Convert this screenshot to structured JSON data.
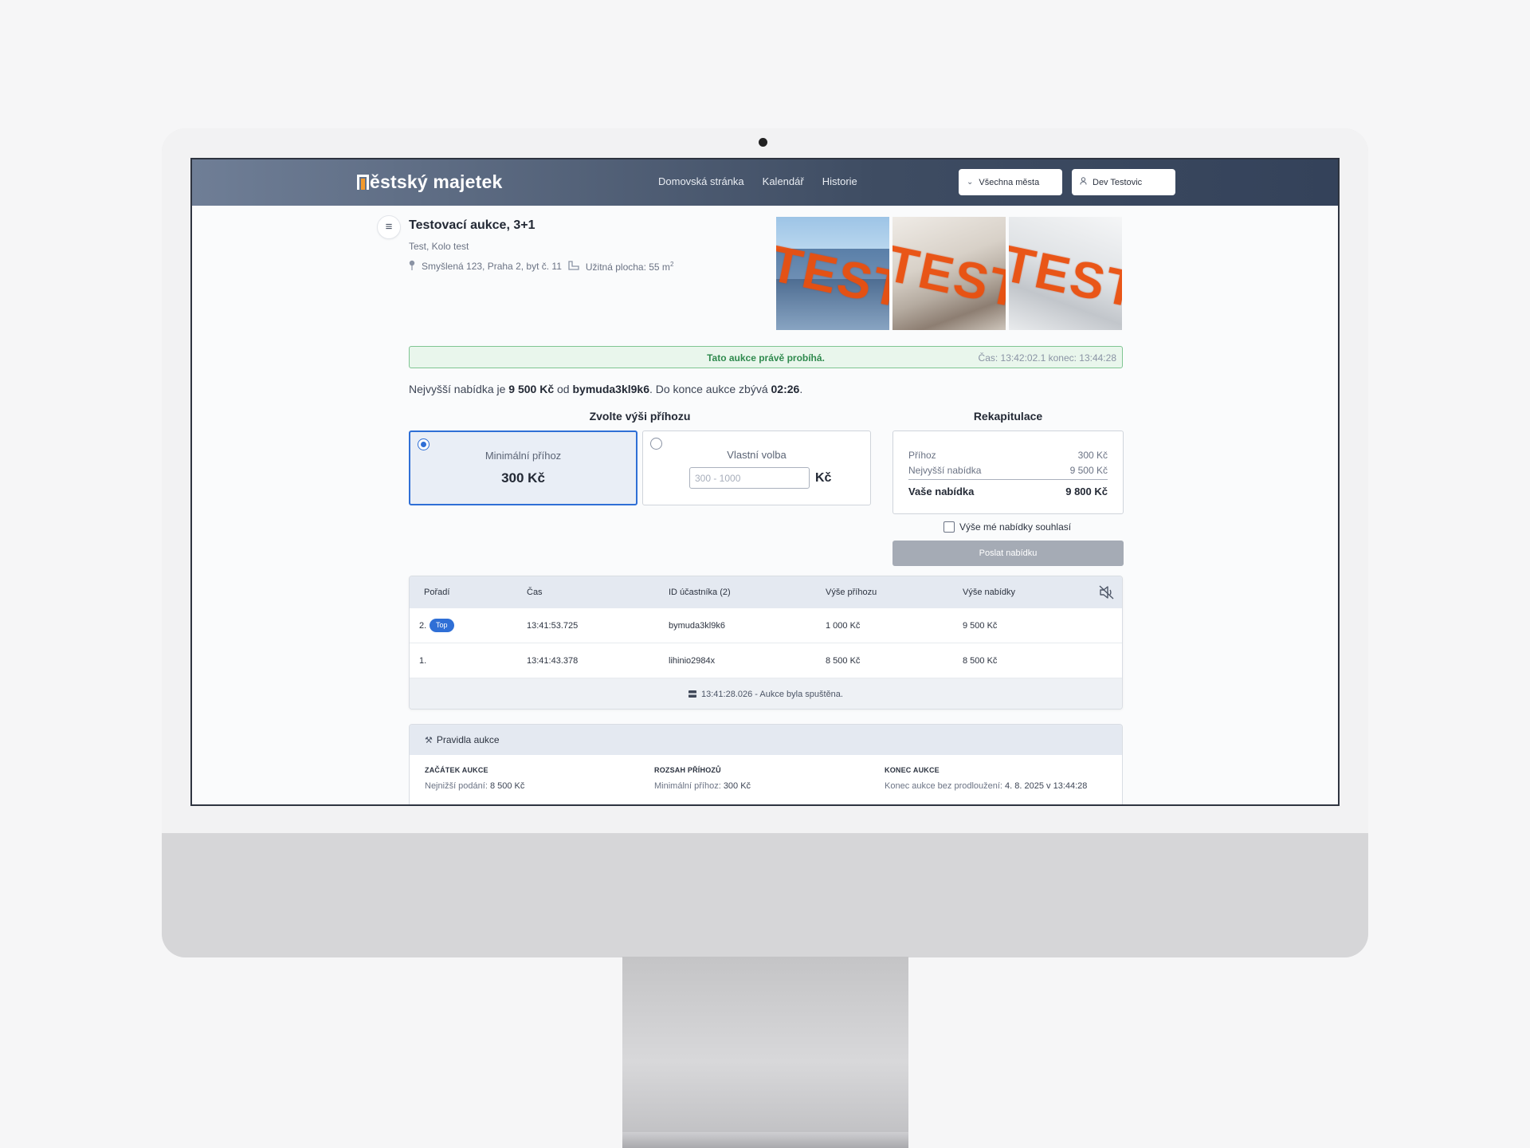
{
  "brand": {
    "logo": "ěstský majetek",
    "logo_color": "#f39a2c"
  },
  "nav": {
    "links": [
      "Domovská stránka",
      "Kalendář",
      "Historie"
    ],
    "city_select": "Všechna města",
    "user": "Dev Testovic"
  },
  "auction": {
    "title": "Testovací aukce, 3+1",
    "subtitle": "Test, Kolo test",
    "address": "Smyšlená 123, Praha 2, byt č. 11",
    "area_label": "Užitná plocha: 55 m",
    "area_unit_sup": "2",
    "photo_stamp": "TEST"
  },
  "status": {
    "text": "Tato aukce právě probíhá.",
    "time": "Čas: 13:42:02.1 konec: 13:44:28"
  },
  "highest": {
    "prefix": "Nejvyšší nabídka je ",
    "amount": "9 500 Kč",
    "from": " od ",
    "bidder": "bymuda3kl9k6",
    "remain": ". Do konce aukce zbývá ",
    "time_left": "02:26",
    "end": "."
  },
  "increment": {
    "title": "Zvolte výši příhozu",
    "min_label": "Minimální příhoz",
    "min_value": "300 Kč",
    "custom_label": "Vlastní volba",
    "custom_placeholder": "300 - 1000",
    "custom_unit": "Kč"
  },
  "recap": {
    "title": "Rekapitulace",
    "rows": [
      {
        "label": "Příhoz",
        "value": "300 Kč"
      },
      {
        "label": "Nejvyšší nabídka",
        "value": "9 500 Kč"
      },
      {
        "label": "Vaše nabídka",
        "value": "9 800 Kč"
      }
    ],
    "agree": "Výše mé nabídky souhlasí",
    "send": "Poslat nabídku"
  },
  "bids": {
    "headers": [
      "Pořadí",
      "Čas",
      "ID účastníka (2)",
      "Výše příhozu",
      "Výše nabídky"
    ],
    "rows": [
      {
        "order": "2.",
        "badge": "Top",
        "time": "13:41:53.725",
        "id": "bymuda3kl9k6",
        "increment": "1 000 Kč",
        "bid": "9 500 Kč"
      },
      {
        "order": "1.",
        "badge": "",
        "time": "13:41:43.378",
        "id": "lihinio2984x",
        "increment": "8 500 Kč",
        "bid": "8 500 Kč"
      }
    ],
    "footer": "13:41:28.026  -  Aukce byla spuštěna."
  },
  "rules": {
    "title": "Pravidla aukce",
    "start_head": "ZAČÁTEK AUKCE",
    "start_value_label": "Nejnižší podání: ",
    "start_value": "8 500 Kč",
    "range_head": "ROZSAH PŘÍHOZŮ",
    "range_value_label": "Minimální příhoz: ",
    "range_value": "300 Kč",
    "end_head": "KONEC AUKCE",
    "end_value_label": "Konec aukce bez prodloužení: ",
    "end_value": "4. 8. 2025 v 13:44:28"
  }
}
